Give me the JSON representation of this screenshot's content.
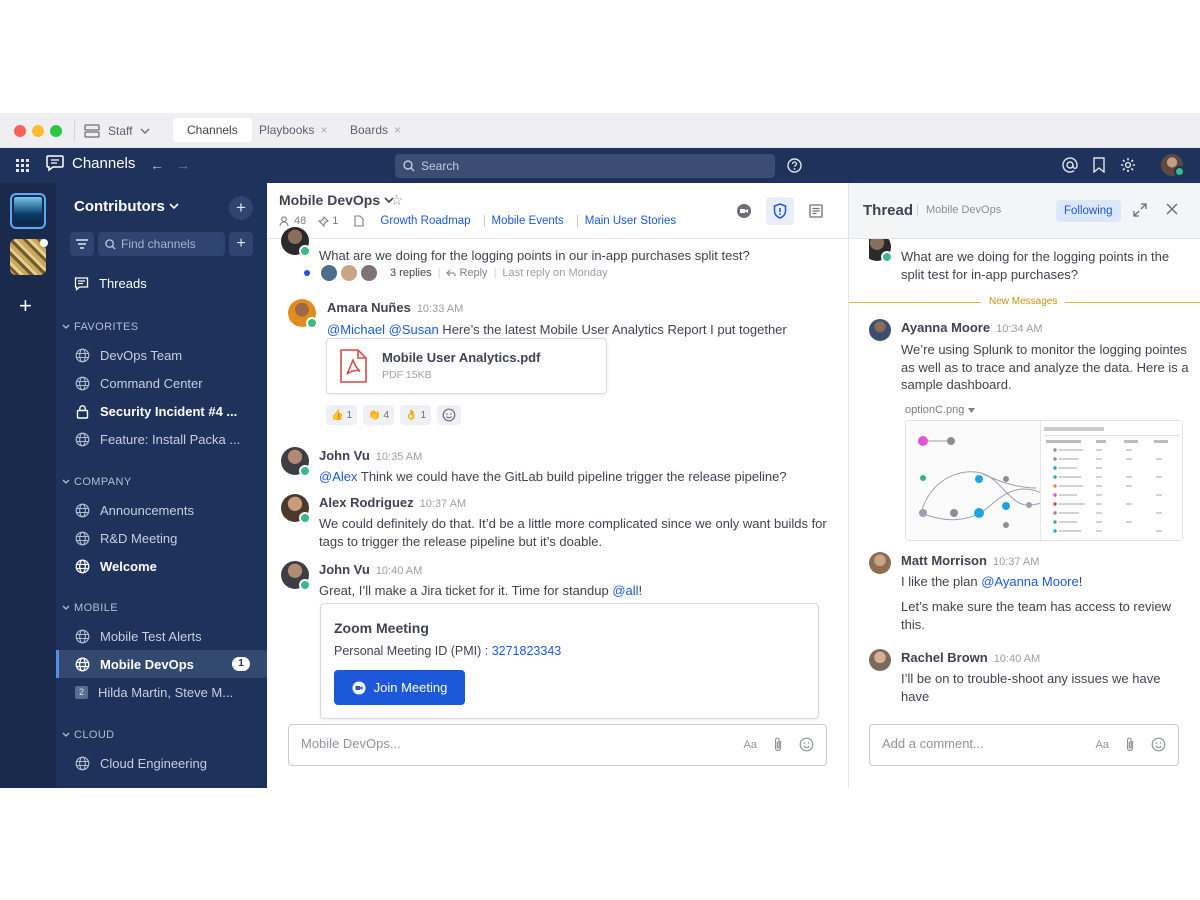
{
  "window": {
    "team_switch_label": "Staff",
    "tabs": [
      {
        "label": "Channels"
      },
      {
        "label": "Playbooks"
      },
      {
        "label": "Boards"
      }
    ]
  },
  "header": {
    "product": "Channels",
    "search_placeholder": "Search"
  },
  "sidebar": {
    "team_name": "Contributors",
    "find_placeholder": "Find channels",
    "threads_label": "Threads",
    "sections": [
      {
        "title": "FAVORITES",
        "items": [
          {
            "label": "DevOps Team"
          },
          {
            "label": "Command Center"
          },
          {
            "label": "Security Incident #4 ..."
          },
          {
            "label": "Feature: Install Packa ..."
          }
        ]
      },
      {
        "title": "COMPANY",
        "items": [
          {
            "label": "Announcements"
          },
          {
            "label": "R&D Meeting"
          },
          {
            "label": "Welcome"
          }
        ]
      },
      {
        "title": "MOBILE",
        "items": [
          {
            "label": "Mobile Test Alerts"
          },
          {
            "label": "Mobile DevOps",
            "badge": "1"
          },
          {
            "label": "Hilda Martin, Steve M...",
            "dm_count": "2"
          }
        ]
      },
      {
        "title": "CLOUD",
        "items": [
          {
            "label": "Cloud Engineering"
          }
        ]
      }
    ]
  },
  "channel": {
    "name": "Mobile DevOps",
    "member_count": "48",
    "pinned_count": "1",
    "links": [
      "Growth Roadmap",
      "Mobile Events",
      "Main User Stories"
    ]
  },
  "posts": {
    "p0": {
      "text": "What are we doing for the logging points in our in-app purchases split test?",
      "replies": "3 replies",
      "reply": "Reply",
      "last_reply": "Last reply on Monday"
    },
    "p1": {
      "author": "Amara Nuñes",
      "time": "10:33 AM",
      "m1": "@Michael",
      "m2": "@Susan",
      "text": " Here’s the latest Mobile User Analytics Report I put together",
      "file_name": "Mobile User Analytics.pdf",
      "file_size": "PDF 15KB",
      "reactions": [
        {
          "emoji": "👍",
          "count": "1"
        },
        {
          "emoji": "👏",
          "count": "4"
        },
        {
          "emoji": "👌",
          "count": "1"
        }
      ]
    },
    "p2": {
      "author": "John Vu",
      "time": "10:35 AM",
      "mention": "@Alex",
      "text": " Think we could have the GitLab build pipeline trigger the release pipeline?"
    },
    "p3": {
      "author": "Alex Rodriguez",
      "time": "10:37 AM",
      "text": "We could definitely do that. It’d be a little more complicated since we only want builds for tags to trigger the release pipeline but it’s doable."
    },
    "p4": {
      "author": "John Vu",
      "time": "10:40 AM",
      "text": "Great, I’ll make a Jira ticket for it. Time for standup ",
      "mention": "@all",
      "tail": "!",
      "zoom_title": "Zoom Meeting",
      "zoom_pmi_label": "Personal Meeting ID (PMI) : ",
      "zoom_pmi": "3271823343",
      "zoom_button": "Join Meeting"
    }
  },
  "composer": {
    "placeholder": "Mobile DevOps...",
    "format_label": "Aa"
  },
  "thread": {
    "title": "Thread",
    "channel": "Mobile DevOps",
    "follow_label": "Following",
    "root_text": "What are we doing for the logging points in the split test for in-app purchases?",
    "new_messages": "New Messages",
    "r1": {
      "author": "Ayanna Moore",
      "time": "10:34 AM",
      "text": "We’re using Splunk to monitor the logging pointes as well as to trace and analyze the data. Here is a sample dashboard.",
      "image_name": "optionC.png"
    },
    "r2": {
      "author": "Matt Morrison",
      "time": "10:37 AM",
      "text1": "I like the plan ",
      "mention": "@Ayanna Moore",
      "tail": "!",
      "text2": "Let’s make sure the team has access to review this."
    },
    "r3": {
      "author": "Rachel Brown",
      "time": "10:40 AM",
      "text": "I’ll be on to trouble-shoot any issues we have have"
    },
    "composer_placeholder": "Add a comment...",
    "format_label": "Aa"
  },
  "colors": {
    "sidebar": "#1e325c",
    "accent": "#1c58d9",
    "online": "#3db887",
    "new_messages": "#e7b53b"
  }
}
